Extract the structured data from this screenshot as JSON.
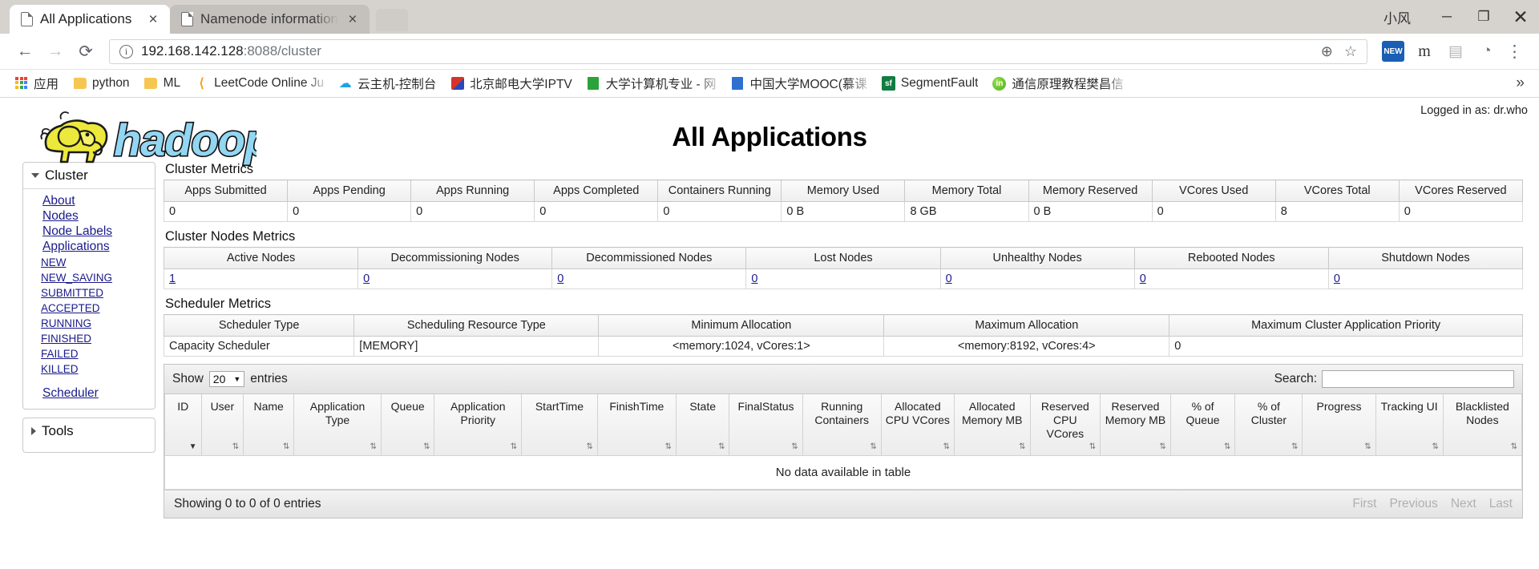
{
  "browser": {
    "tabs": [
      {
        "title": "All Applications",
        "active": true,
        "close_label": "×"
      },
      {
        "title": "Namenode information",
        "active": false,
        "close_label": "×"
      }
    ],
    "window": {
      "user_label": "小风",
      "minimize": "─",
      "maximize": "❐",
      "close": "✕"
    },
    "nav": {
      "back": "←",
      "forward": "→",
      "reload": "⟳",
      "info_icon": "i",
      "url_host": "192.168.142.128",
      "url_rest": ":8088/cluster",
      "zoom_icon": "⊕",
      "star_icon": "☆",
      "menu_icon": "⋮",
      "ext_new": "NEW",
      "ext_m": "m",
      "ext_grey": "▤",
      "ext_c": "◔"
    },
    "bookmarks": {
      "items": [
        {
          "label": "应用",
          "icon": "apps-grid-icon"
        },
        {
          "label": "python",
          "icon": "folder-icon"
        },
        {
          "label": "ML",
          "icon": "folder-icon"
        },
        {
          "label": "LeetCode Online Ju",
          "icon": "leetcode-icon"
        },
        {
          "label": "云主机-控制台",
          "icon": "cloud-icon"
        },
        {
          "label": "北京邮电大学IPTV",
          "icon": "bupt-icon"
        },
        {
          "label": "大学计算机专业 - 网",
          "icon": "green-book-icon"
        },
        {
          "label": "中国大学MOOC(慕课",
          "icon": "blue-book-icon"
        },
        {
          "label": "SegmentFault",
          "icon": "segmentfault-icon"
        },
        {
          "label": "通信原理教程樊昌信",
          "icon": "linkedin-green-icon"
        }
      ],
      "overflow": "»"
    }
  },
  "page": {
    "logged_in": "Logged in as: dr.who",
    "title": "All Applications",
    "logo_alt": "hadoop"
  },
  "sidebar": {
    "cluster": {
      "header": "Cluster",
      "items": [
        {
          "label": "About"
        },
        {
          "label": "Nodes"
        },
        {
          "label": "Node Labels"
        },
        {
          "label": "Applications"
        }
      ],
      "app_states": [
        {
          "label": "NEW"
        },
        {
          "label": "NEW_SAVING"
        },
        {
          "label": "SUBMITTED"
        },
        {
          "label": "ACCEPTED"
        },
        {
          "label": "RUNNING"
        },
        {
          "label": "FINISHED"
        },
        {
          "label": "FAILED"
        },
        {
          "label": "KILLED"
        }
      ],
      "scheduler": "Scheduler"
    },
    "tools": {
      "header": "Tools"
    }
  },
  "cluster_metrics": {
    "title": "Cluster Metrics",
    "headers": [
      "Apps Submitted",
      "Apps Pending",
      "Apps Running",
      "Apps Completed",
      "Containers Running",
      "Memory Used",
      "Memory Total",
      "Memory Reserved",
      "VCores Used",
      "VCores Total",
      "VCores Reserved"
    ],
    "values": [
      "0",
      "0",
      "0",
      "0",
      "0",
      "0 B",
      "8 GB",
      "0 B",
      "0",
      "8",
      "0"
    ]
  },
  "cluster_nodes_metrics": {
    "title": "Cluster Nodes Metrics",
    "headers": [
      "Active Nodes",
      "Decommissioning Nodes",
      "Decommissioned Nodes",
      "Lost Nodes",
      "Unhealthy Nodes",
      "Rebooted Nodes",
      "Shutdown Nodes"
    ],
    "values": [
      "1",
      "0",
      "0",
      "0",
      "0",
      "0",
      "0"
    ]
  },
  "scheduler_metrics": {
    "title": "Scheduler Metrics",
    "headers": [
      "Scheduler Type",
      "Scheduling Resource Type",
      "Minimum Allocation",
      "Maximum Allocation",
      "Maximum Cluster Application Priority"
    ],
    "values": [
      "Capacity Scheduler",
      "[MEMORY]",
      "<memory:1024, vCores:1>",
      "<memory:8192, vCores:4>",
      "0"
    ]
  },
  "applications_table": {
    "show_label": "Show",
    "entries_value": "20",
    "entries_label": "entries",
    "search_label": "Search:",
    "search_value": "",
    "columns": [
      {
        "label": "ID",
        "sort": "▼",
        "sorted": true
      },
      {
        "label": "User",
        "sort": "⇅"
      },
      {
        "label": "Name",
        "sort": "⇅"
      },
      {
        "label": "Application Type",
        "sort": "⇅"
      },
      {
        "label": "Queue",
        "sort": "⇅"
      },
      {
        "label": "Application Priority",
        "sort": "⇅"
      },
      {
        "label": "StartTime",
        "sort": "⇅"
      },
      {
        "label": "FinishTime",
        "sort": "⇅"
      },
      {
        "label": "State",
        "sort": "⇅"
      },
      {
        "label": "FinalStatus",
        "sort": "⇅"
      },
      {
        "label": "Running Containers",
        "sort": "⇅"
      },
      {
        "label": "Allocated CPU VCores",
        "sort": "⇅"
      },
      {
        "label": "Allocated Memory MB",
        "sort": "⇅"
      },
      {
        "label": "Reserved CPU VCores",
        "sort": "⇅"
      },
      {
        "label": "Reserved Memory MB",
        "sort": "⇅"
      },
      {
        "label": "% of Queue",
        "sort": "⇅"
      },
      {
        "label": "% of Cluster",
        "sort": "⇅"
      },
      {
        "label": "Progress",
        "sort": "⇅"
      },
      {
        "label": "Tracking UI",
        "sort": "⇅"
      },
      {
        "label": "Blacklisted Nodes",
        "sort": "⇅"
      }
    ],
    "empty_message": "No data available in table",
    "info": "Showing 0 to 0 of 0 entries",
    "pager": [
      "First",
      "Previous",
      "Next",
      "Last"
    ]
  }
}
